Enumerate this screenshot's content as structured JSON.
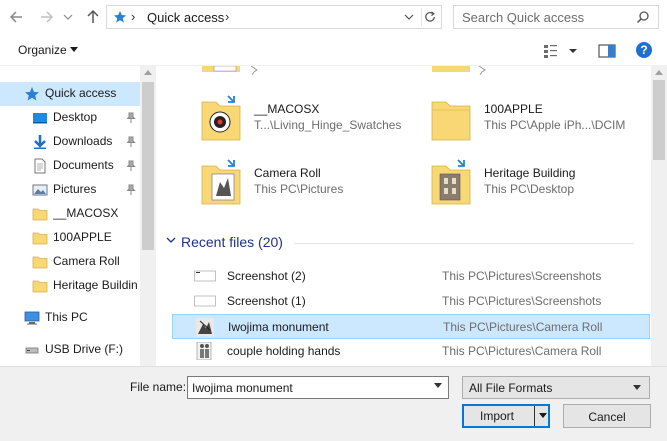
{
  "address": {
    "location": "Quick access",
    "search_placeholder": "Search Quick access"
  },
  "toolbar": {
    "organize_label": "Organize",
    "help_label": "?"
  },
  "nav": {
    "items": [
      {
        "label": "Quick access",
        "icon": "star-icon",
        "selected": true
      },
      {
        "label": "Desktop",
        "icon": "desktop-icon",
        "pinned": true
      },
      {
        "label": "Downloads",
        "icon": "download-icon",
        "pinned": true
      },
      {
        "label": "Documents",
        "icon": "documents-icon",
        "pinned": true
      },
      {
        "label": "Pictures",
        "icon": "pictures-icon",
        "pinned": true
      },
      {
        "label": "__MACOSX",
        "icon": "folder-icon"
      },
      {
        "label": "100APPLE",
        "icon": "folder-icon"
      },
      {
        "label": "Camera Roll",
        "icon": "folder-icon"
      },
      {
        "label": "Heritage Buildin",
        "icon": "folder-icon"
      },
      {
        "label": "This PC",
        "icon": "computer-icon"
      },
      {
        "label": "USB Drive (F:)",
        "icon": "usb-drive-icon"
      }
    ]
  },
  "frequent": [
    {
      "name": "__MACOSX",
      "path": "T...\\Living_Hinge_Swatches"
    },
    {
      "name": "100APPLE",
      "path": "This PC\\Apple iPh...\\DCIM"
    },
    {
      "name": "Camera Roll",
      "path": "This PC\\Pictures"
    },
    {
      "name": "Heritage Building",
      "path": "This PC\\Desktop"
    }
  ],
  "recent": {
    "header": "Recent files (20)",
    "items": [
      {
        "name": "Screenshot (2)",
        "path": "This PC\\Pictures\\Screenshots"
      },
      {
        "name": "Screenshot (1)",
        "path": "This PC\\Pictures\\Screenshots"
      },
      {
        "name": "Iwojima monument",
        "path": "This PC\\Pictures\\Camera Roll",
        "selected": true
      },
      {
        "name": "couple holding hands",
        "path": "This PC\\Pictures\\Camera Roll"
      }
    ]
  },
  "footer": {
    "file_name_label": "File name:",
    "file_name_value": "Iwojima monument",
    "file_type": "All File Formats",
    "import_label": "Import",
    "cancel_label": "Cancel"
  },
  "colors": {
    "selection": "#cce8ff",
    "accent": "#0078d7",
    "recent_header": "#1e3287",
    "folder": "#f8d775"
  }
}
